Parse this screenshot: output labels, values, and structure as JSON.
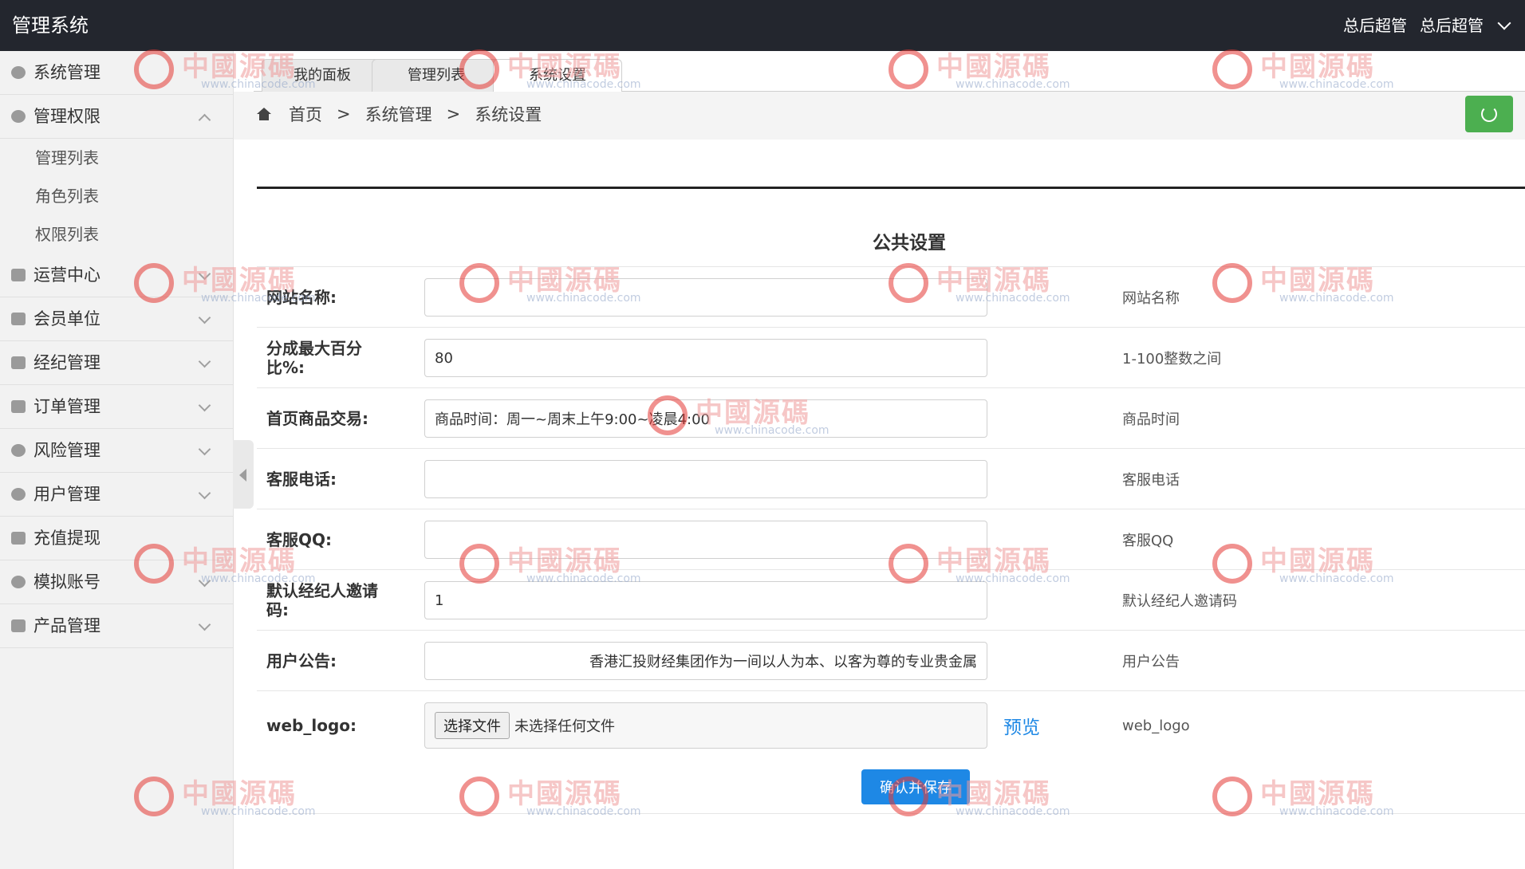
{
  "app": {
    "title": "管理系统",
    "user_name": "总后超管",
    "user_menu": "总后超管"
  },
  "sidebar": {
    "items": [
      {
        "label": "系统管理",
        "icon": "gear-icon"
      },
      {
        "label": "管理权限",
        "icon": "user-icon",
        "expanded": true,
        "children": [
          "管理列表",
          "角色列表",
          "权限列表"
        ]
      },
      {
        "label": "运营中心",
        "icon": "list-icon"
      },
      {
        "label": "会员单位",
        "icon": "list-icon"
      },
      {
        "label": "经纪管理",
        "icon": "card-icon"
      },
      {
        "label": "订单管理",
        "icon": "order-icon"
      },
      {
        "label": "风险管理",
        "icon": "risk-icon"
      },
      {
        "label": "用户管理",
        "icon": "user-icon"
      },
      {
        "label": "充值提现",
        "icon": "order-icon"
      },
      {
        "label": "模拟账号",
        "icon": "user-icon"
      },
      {
        "label": "产品管理",
        "icon": "bag-icon"
      }
    ]
  },
  "tabs": [
    "我的面板",
    "管理列表",
    "系统设置"
  ],
  "breadcrumb": [
    "首页",
    ">",
    "系统管理",
    ">",
    "系统设置"
  ],
  "form": {
    "section_title": "公共设置",
    "rows": [
      {
        "label": "网站名称:",
        "value": "",
        "hint": "网站名称"
      },
      {
        "label": "分成最大百分比%:",
        "value": "80",
        "hint": "1-100整数之间"
      },
      {
        "label": "首页商品交易:",
        "value": "商品时间：周一~周末上午9:00~凌晨4:00",
        "hint": "商品时间"
      },
      {
        "label": "客服电话:",
        "value": "",
        "hint": "客服电话"
      },
      {
        "label": "客服QQ:",
        "value": "",
        "hint": "客服QQ"
      },
      {
        "label": "默认经纪人邀请码:",
        "value": "1",
        "hint": "默认经纪人邀请码"
      },
      {
        "label": "用户公告:",
        "value": "香港汇投财经集团作为一间以人为本、以客为尊的专业贵金属",
        "hint": "用户公告"
      }
    ],
    "logo_row": {
      "label": "web_logo:",
      "file_button": "选择文件",
      "file_status": "未选择任何文件",
      "preview": "预览",
      "hint": "web_logo"
    },
    "submit": "确认并保存"
  },
  "watermark": {
    "text": "中國源碼",
    "url": "www.chinacode.com"
  },
  "colors": {
    "header": "#23262e",
    "sidebar": "#f2f2f2",
    "primary": "#1e88e5",
    "refresh": "#4caf50"
  }
}
